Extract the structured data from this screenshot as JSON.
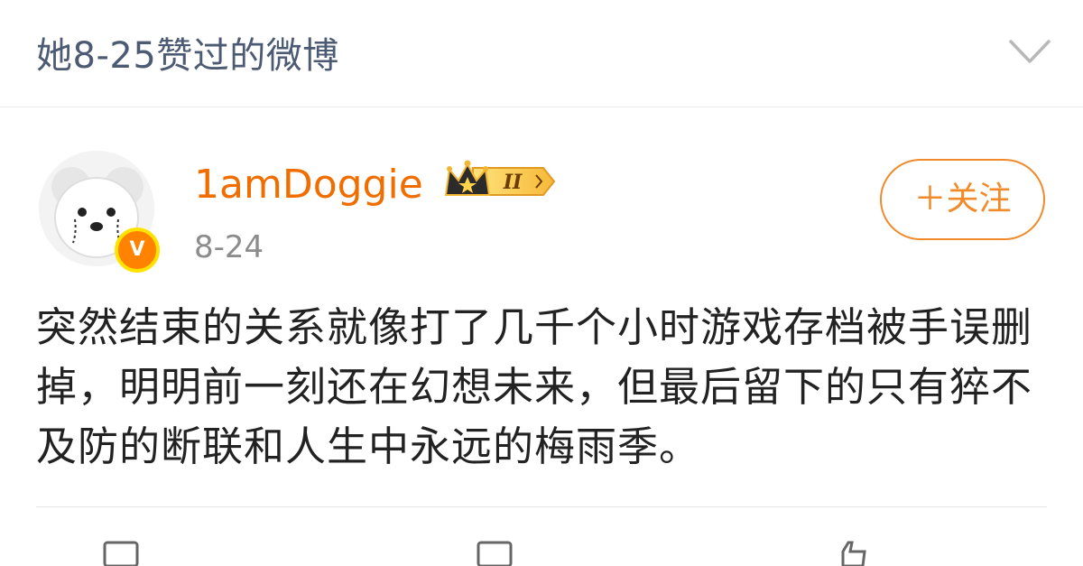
{
  "header": {
    "title": "她8-25赞过的微博"
  },
  "post": {
    "author": {
      "name": "1amDoggie",
      "vip_level": "II",
      "verified": true
    },
    "date": "8-24",
    "follow_label": "＋关注",
    "text": "突然结束的关系就像打了几千个小时游戏存档被手误删掉，明明前一刻还在幻想未来，但最后留下的只有猝不及防的断联和人生中永远的梅雨季。"
  },
  "actions": [
    {
      "icon": "repost-icon"
    },
    {
      "icon": "comment-icon"
    },
    {
      "icon": "like-icon"
    }
  ],
  "colors": {
    "username": "#f06e00",
    "accent": "#f08a2a",
    "title": "#4c5b73",
    "text": "#222222",
    "date": "#8c8c8c"
  }
}
